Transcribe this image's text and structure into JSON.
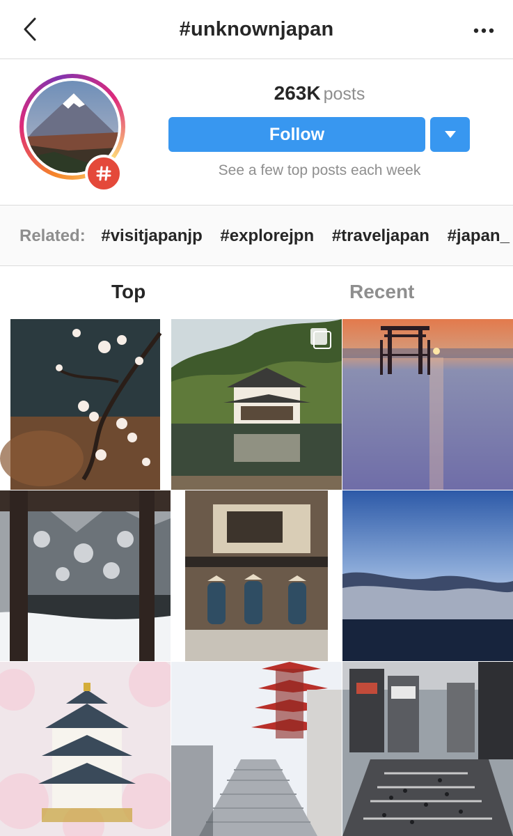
{
  "header": {
    "title": "#unknownjapan"
  },
  "profile": {
    "posts_count": "263K",
    "posts_label": "posts",
    "follow_label": "Follow",
    "subtext": "See a few top posts each week",
    "badge_symbol": "#"
  },
  "related": {
    "label": "Related:",
    "tags": [
      "#visitjapanjp",
      "#explorejpn",
      "#traveljapan",
      "#japan_"
    ]
  },
  "tabs": {
    "top": "Top",
    "recent": "Recent",
    "active": "Top"
  },
  "grid": {
    "tiles": [
      {
        "subject": "plum-blossom-branch"
      },
      {
        "subject": "golden-pavilion-reflection"
      },
      {
        "subject": "floating-torii-sunset"
      },
      {
        "subject": "snowy-garden-veranda"
      },
      {
        "subject": "monks-walking-street"
      },
      {
        "subject": "ocean-blue-sky-clouds"
      },
      {
        "subject": "osaka-castle-cherry-blossoms"
      },
      {
        "subject": "pagoda-stone-stairs"
      },
      {
        "subject": "shibuya-crossing"
      }
    ]
  },
  "colors": {
    "accent": "#3897f0",
    "badge": "#e4493a",
    "text": "#262626",
    "muted": "#8e8e8e"
  }
}
